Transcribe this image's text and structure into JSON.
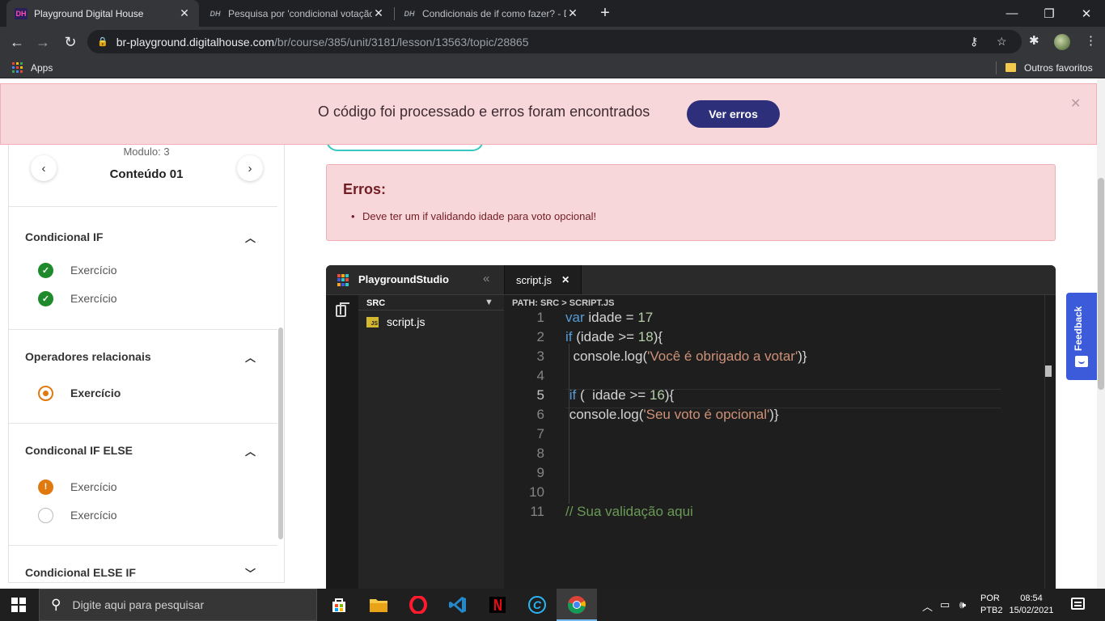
{
  "browser": {
    "tabs": [
      {
        "favicon": "DH",
        "title": "Playground Digital House",
        "active": true
      },
      {
        "favicon": "DH",
        "title": "Pesquisa por 'condicional votação",
        "active": false
      },
      {
        "favicon": "DH",
        "title": "Condicionais de if como fazer? - D",
        "active": false
      }
    ],
    "url_host": "br-playground.digitalhouse.com",
    "url_path": "/br/course/385/unit/3181/lesson/13563/topic/28865",
    "bookmarks": {
      "apps_label": "Apps",
      "others_label": "Outros favoritos"
    }
  },
  "alert": {
    "message": "O código foi processado e erros foram encontrados",
    "button_label": "Ver erros"
  },
  "sidebar": {
    "module_label": "Modulo: 3",
    "content_title": "Conteúdo 01",
    "sections": [
      {
        "title": "Condicional IF",
        "items": [
          {
            "label": "Exercício",
            "status": "done"
          },
          {
            "label": "Exercício",
            "status": "done"
          }
        ]
      },
      {
        "title": "Operadores relacionais",
        "items": [
          {
            "label": "Exercício",
            "status": "current"
          }
        ]
      },
      {
        "title": "Condiconal IF ELSE",
        "items": [
          {
            "label": "Exercício",
            "status": "warning"
          },
          {
            "label": "Exercício",
            "status": "empty"
          }
        ]
      },
      {
        "title": "Condicional ELSE IF",
        "items": []
      }
    ]
  },
  "errors": {
    "title": "Erros:",
    "items": [
      "Deve ter um if validando idade para voto opcional!"
    ]
  },
  "editor": {
    "studio_title": "PlaygroundStudio",
    "open_tab": "script.js",
    "folder_label": "SRC",
    "file_name": "script.js",
    "file_badge": "JS",
    "path_label": "PATH: SRC > SCRIPT.JS",
    "active_line": 5,
    "line_numbers": [
      "1",
      "2",
      "3",
      "4",
      "5",
      "6",
      "7",
      "8",
      "9",
      "10",
      "11"
    ],
    "code_lines": [
      [
        {
          "t": "kw",
          "v": "var"
        },
        {
          "t": "",
          "v": " idade = "
        },
        {
          "t": "num",
          "v": "17"
        }
      ],
      [
        {
          "t": "kw",
          "v": "if"
        },
        {
          "t": "",
          "v": " (idade >= "
        },
        {
          "t": "num",
          "v": "18"
        },
        {
          "t": "",
          "v": "){"
        }
      ],
      [
        {
          "t": "",
          "v": "  console.log("
        },
        {
          "t": "str",
          "v": "'Você é obrigado a votar'"
        },
        {
          "t": "",
          "v": ")}"
        }
      ],
      [],
      [
        {
          "t": "",
          "v": " "
        },
        {
          "t": "kw",
          "v": "if"
        },
        {
          "t": "",
          "v": " (  idade >= "
        },
        {
          "t": "num",
          "v": "16"
        },
        {
          "t": "",
          "v": "){"
        }
      ],
      [
        {
          "t": "",
          "v": " console.log("
        },
        {
          "t": "str",
          "v": "'Seu voto é opcional'"
        },
        {
          "t": "",
          "v": ")}"
        }
      ],
      [],
      [],
      [],
      [],
      [
        {
          "t": "cm",
          "v": "// Sua validação aqui"
        }
      ]
    ]
  },
  "feedback_label": "Feedback",
  "taskbar": {
    "search_placeholder": "Digite aqui para pesquisar",
    "lang_top": "POR",
    "lang_bottom": "PTB2",
    "time": "08:54",
    "date": "15/02/2021"
  },
  "colors": {
    "alert_bg": "#f8d7da",
    "alert_button": "#2d2f7a",
    "done": "#1e8a2c",
    "warning": "#e07a10",
    "feedback": "#3b5bdb",
    "editor_bg": "#1e1e1e"
  }
}
